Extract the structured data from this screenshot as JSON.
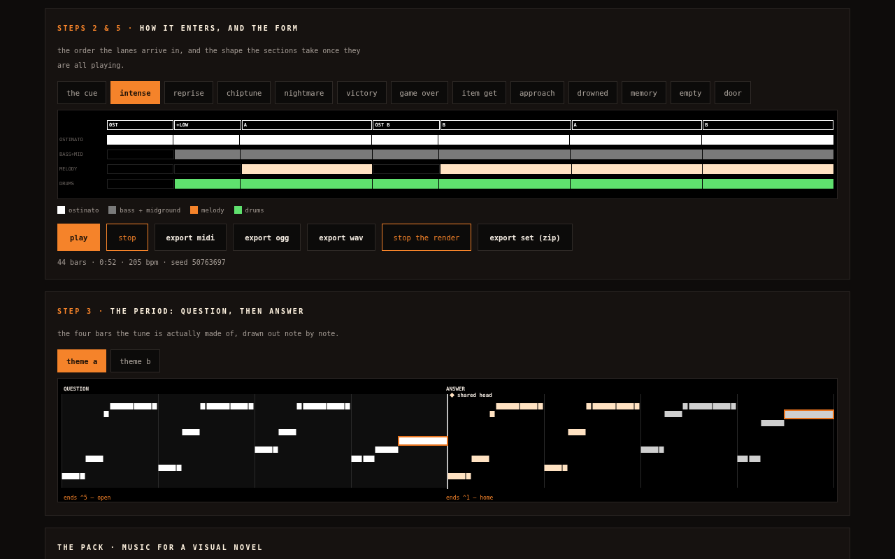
{
  "steps_section": {
    "step": "STEPS 2 & 5",
    "separator": "·",
    "title": "HOW IT ENTERS, AND THE FORM",
    "description": "the order the lanes arrive in, and the shape the sections take once they are all playing.",
    "tabs": [
      {
        "label": "the cue",
        "selected": false
      },
      {
        "label": "intense",
        "selected": true
      },
      {
        "label": "reprise",
        "selected": false
      },
      {
        "label": "chiptune",
        "selected": false
      },
      {
        "label": "nightmare",
        "selected": false
      },
      {
        "label": "victory",
        "selected": false
      },
      {
        "label": "game over",
        "selected": false
      },
      {
        "label": "item get",
        "selected": false
      },
      {
        "label": "approach",
        "selected": false
      },
      {
        "label": "drowned",
        "selected": false
      },
      {
        "label": "memory",
        "selected": false
      },
      {
        "label": "empty",
        "selected": false
      },
      {
        "label": "door",
        "selected": false
      }
    ],
    "timeline": {
      "sections": [
        {
          "label": "OST",
          "kind": "short"
        },
        {
          "label": "+LOW",
          "kind": "short"
        },
        {
          "label": "A",
          "kind": "long"
        },
        {
          "label": "OST B",
          "kind": "short"
        },
        {
          "label": "B",
          "kind": "long"
        },
        {
          "label": "A",
          "kind": "long"
        },
        {
          "label": "B",
          "kind": "long"
        }
      ],
      "lanes": [
        {
          "name": "OSTINATO",
          "color": "#ffffff",
          "active": [
            true,
            true,
            true,
            true,
            true,
            true,
            true
          ]
        },
        {
          "name": "BASS+MID",
          "color": "#7a7a7a",
          "active": [
            false,
            true,
            true,
            true,
            true,
            true,
            true
          ]
        },
        {
          "name": "MELODY",
          "color": "#ffe2c2",
          "active": [
            false,
            false,
            true,
            false,
            true,
            true,
            true
          ]
        },
        {
          "name": "DRUMS",
          "color": "#5fe06e",
          "active": [
            false,
            true,
            true,
            true,
            true,
            true,
            true
          ]
        }
      ]
    },
    "legend": [
      {
        "label": "ostinato",
        "color": "#ffffff"
      },
      {
        "label": "bass + midground",
        "color": "#7a7a7a"
      },
      {
        "label": "melody",
        "color": "#f5832a"
      },
      {
        "label": "drums",
        "color": "#5fe06e"
      }
    ],
    "buttons": [
      {
        "label": "play",
        "kind": "primary"
      },
      {
        "label": "stop",
        "kind": "outline"
      },
      {
        "label": "export midi",
        "kind": "plain"
      },
      {
        "label": "export ogg",
        "kind": "plain"
      },
      {
        "label": "export wav",
        "kind": "plain"
      },
      {
        "label": "stop the render",
        "kind": "outline"
      },
      {
        "label": "export set (zip)",
        "kind": "plain"
      }
    ],
    "stats": "44 bars · 0:52 · 205 bpm · seed 50763697"
  },
  "period_section": {
    "step": "STEP 3",
    "separator": "·",
    "title": "THE PERIOD: QUESTION, THEN ANSWER",
    "description": "the four bars the tune is actually made of, drawn out note by note.",
    "tabs": [
      {
        "label": "theme a",
        "selected": true
      },
      {
        "label": "theme b",
        "selected": false
      }
    ],
    "roll": {
      "question_label": "QUESTION",
      "answer_label": "ANSWER",
      "shared_label": "shared head",
      "question_ending": "ends ^5 – open",
      "answer_ending": "ends ^1 – home"
    }
  },
  "pack_section": {
    "title": "THE PACK · MUSIC FOR A VISUAL NOVEL"
  }
}
